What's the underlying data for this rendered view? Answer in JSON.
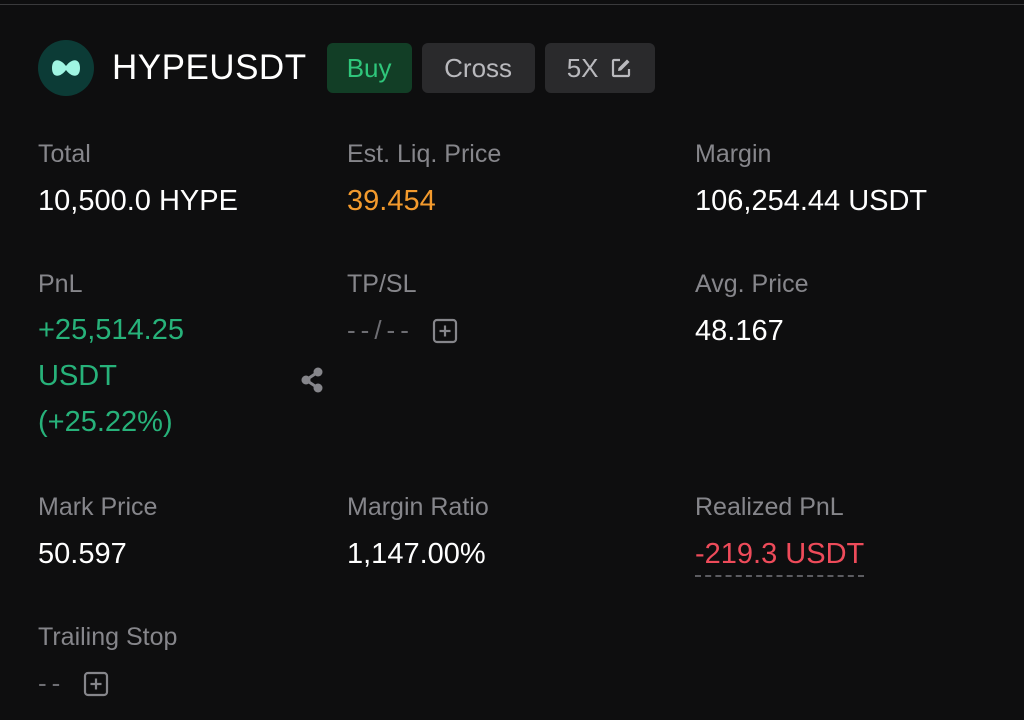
{
  "colors": {
    "background": "#0e0e0f",
    "positive": "#27b27a",
    "negative": "#ee4b5a",
    "warning": "#f39a2d",
    "label": "#86868b"
  },
  "header": {
    "logo_icon": "hype-logo-icon",
    "pair": "HYPEUSDT",
    "side": "Buy",
    "margin_mode": "Cross",
    "leverage": "5X",
    "leverage_icon": "edit-icon"
  },
  "fields": {
    "total": {
      "label": "Total",
      "value": "10,500.0 HYPE"
    },
    "est_liq": {
      "label": "Est. Liq. Price",
      "value": "39.454"
    },
    "margin": {
      "label": "Margin",
      "value": "106,254.44 USDT"
    },
    "pnl": {
      "label": "PnL",
      "amount": "+25,514.25",
      "unit": "USDT",
      "percent": "(+25.22%)",
      "share_icon": "share-icon"
    },
    "tpsl": {
      "label": "TP/SL",
      "value": "--/--",
      "add_icon": "plus-square-icon"
    },
    "avg_price": {
      "label": "Avg. Price",
      "value": "48.167"
    },
    "mark_price": {
      "label": "Mark Price",
      "value": "50.597"
    },
    "margin_ratio": {
      "label": "Margin Ratio",
      "value": "1,147.00%"
    },
    "realized_pnl": {
      "label": "Realized PnL",
      "value": "-219.3 USDT"
    },
    "trailing_stop": {
      "label": "Trailing Stop",
      "value": "--",
      "add_icon": "plus-square-icon"
    }
  }
}
